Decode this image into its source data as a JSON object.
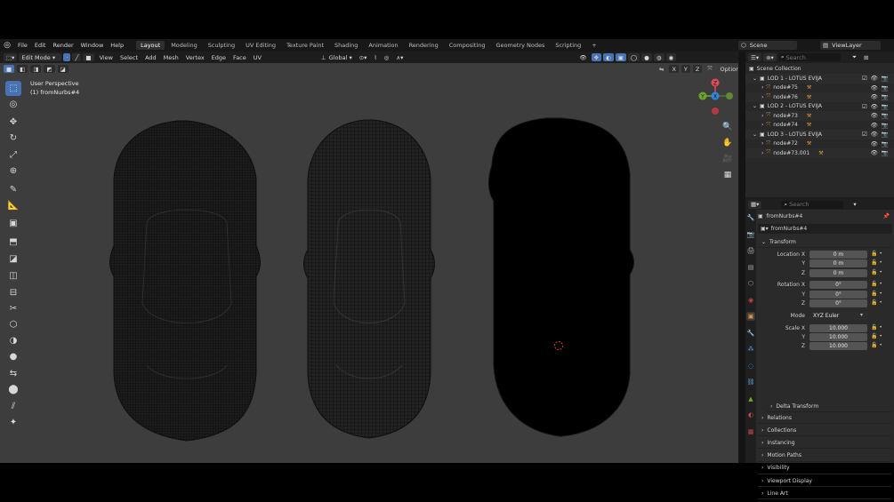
{
  "top_menu": {
    "logo": "blender-logo-icon",
    "items": [
      "File",
      "Edit",
      "Render",
      "Window",
      "Help"
    ],
    "workspaces": [
      "Layout",
      "Modeling",
      "Sculpting",
      "UV Editing",
      "Texture Paint",
      "Shading",
      "Animation",
      "Rendering",
      "Compositing",
      "Geometry Nodes",
      "Scripting"
    ],
    "active_workspace": "Layout",
    "add_workspace": "+",
    "scene": "Scene",
    "view_layer": "ViewLayer"
  },
  "viewport_header": {
    "mode": "Edit Mode",
    "menus": [
      "View",
      "Select",
      "Add",
      "Mesh",
      "Vertex",
      "Edge",
      "Face",
      "UV"
    ],
    "orientation": "Global",
    "options": "Options",
    "axes": [
      "X",
      "Y",
      "Z"
    ]
  },
  "viewport": {
    "perspective_label": "User Perspective",
    "object_label": "(1) fromNurbs#4",
    "gizmo": {
      "x": "X",
      "y": "Y",
      "z": "Z"
    },
    "tools": [
      "select-box-icon",
      "cursor-icon",
      "move-icon",
      "rotate-icon",
      "scale-icon",
      "transform-icon",
      "annotate-icon",
      "measure-icon",
      "add-cube-icon",
      "extrude-icon",
      "inset-icon",
      "bevel-icon",
      "loop-cut-icon",
      "knife-icon",
      "poly-build-icon",
      "spin-icon",
      "smooth-icon",
      "edge-slide-icon",
      "shrink-fatten-icon",
      "shear-icon",
      "rip-icon"
    ]
  },
  "outliner": {
    "search_placeholder": "Search",
    "root": "Scene Collection",
    "rows": [
      {
        "label": "LOD 1 - LOTUS EVIJA",
        "type": "collection"
      },
      {
        "label": "node#75",
        "type": "object"
      },
      {
        "label": "node#76",
        "type": "object"
      },
      {
        "label": "LOD 2 - LOTUS EVIJA",
        "type": "collection"
      },
      {
        "label": "node#73",
        "type": "object"
      },
      {
        "label": "node#74",
        "type": "object"
      },
      {
        "label": "LOD 3 - LOTUS EVIJA",
        "type": "collection"
      },
      {
        "label": "node#72",
        "type": "object"
      },
      {
        "label": "node#73.001",
        "type": "object"
      }
    ]
  },
  "properties": {
    "search_placeholder": "Search",
    "object_name": "fromNurbs#4",
    "data_name": "fromNurbs#4",
    "transform": {
      "title": "Transform",
      "location_label": "Location X",
      "location": [
        "0 m",
        "0 m",
        "0 m"
      ],
      "rotation_label": "Rotation X",
      "rotation": [
        "0°",
        "0°",
        "0°"
      ],
      "mode_label": "Mode",
      "mode": "XYZ Euler",
      "scale_label": "Scale X",
      "scale": [
        "10.000",
        "10.000",
        "10.000"
      ],
      "y": "Y",
      "z": "Z"
    },
    "sections": [
      "Delta Transform",
      "Relations",
      "Collections",
      "Instancing",
      "Motion Paths",
      "Visibility",
      "Viewport Display",
      "Line Art"
    ]
  },
  "colors": {
    "accent": "#4772b3",
    "viewport_bg": "#3d3d3d",
    "panel_bg": "#2a2a2a",
    "axis_x": "#e44b54",
    "axis_y": "#6ea828",
    "axis_z": "#2e86e0"
  }
}
